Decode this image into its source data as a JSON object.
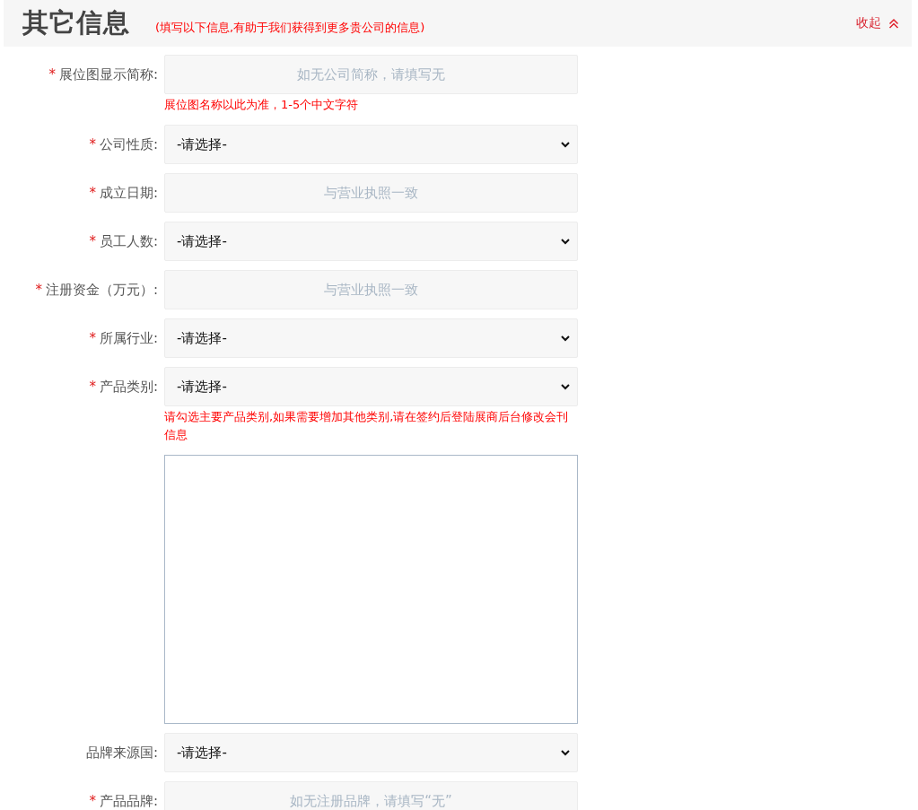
{
  "header": {
    "title": "其它信息",
    "subtitle": "(填写以下信息,有助于我们获得到更多贵公司的信息)",
    "collapse_label": "收起"
  },
  "items": [
    {
      "kind": "input",
      "marker": "*",
      "label": "展位图显示简称:",
      "placeholder": "如无公司简称，请填写无"
    },
    {
      "kind": "hint",
      "text": "展位图名称以此为准，1-5个中文字符"
    },
    {
      "kind": "select",
      "marker": "*",
      "label": "公司性质:",
      "value": "-请选择-"
    },
    {
      "kind": "input",
      "marker": "*",
      "label": "成立日期:",
      "placeholder": "与营业执照一致"
    },
    {
      "kind": "select",
      "marker": "*",
      "label": "员工人数:",
      "value": "-请选择-"
    },
    {
      "kind": "input",
      "marker": "*",
      "label": "注册资金（万元）:",
      "placeholder": "与营业执照一致"
    },
    {
      "kind": "select",
      "marker": "*",
      "label": "所属行业:",
      "value": "-请选择-"
    },
    {
      "kind": "select",
      "marker": "*",
      "label": "产品类别:",
      "value": "-请选择-"
    },
    {
      "kind": "hint",
      "text": "请勾选主要产品类别,如果需要增加其他类别,请在签约后登陆展商后台修改会刊信息"
    },
    {
      "kind": "textarea"
    },
    {
      "kind": "select",
      "label": "品牌来源国:",
      "value": "-请选择-"
    },
    {
      "kind": "input",
      "marker": "*",
      "label": "产品品牌:",
      "placeholder": "如无注册品牌，请填写“无”"
    }
  ]
}
